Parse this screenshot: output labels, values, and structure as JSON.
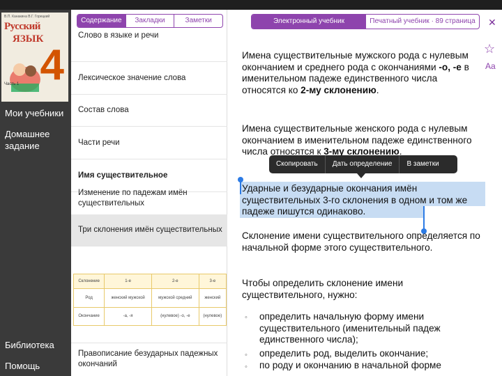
{
  "cover": {
    "authors": "В.П. Канакина  В.Г. Горецкий",
    "title_line1": "Русский",
    "title_line2": "ЯЗЫК",
    "grade": "4",
    "part": "Часть 1"
  },
  "sidebar": {
    "my_textbooks": "Мои учебники",
    "homework": "Домашнее задание",
    "library": "Библиотека",
    "help": "Помощь"
  },
  "toc_tabs": [
    "Содержание",
    "Закладки",
    "Заметки"
  ],
  "toc_items": [
    "Слово в языке и речи",
    "Лексическое значение слова",
    "Состав слова",
    "Части речи",
    "Имя существительное",
    "Изменение по падежам имён существительных",
    "Три склонения имён существительных",
    "Правописание безударных падежных окончаний"
  ],
  "mini_table": {
    "headers": [
      "Склонение",
      "1-е",
      "2-е",
      "3-е"
    ],
    "row1": [
      "Род",
      "женский мужской",
      "мужской средний",
      "женский"
    ],
    "row2": [
      "Окончание",
      "-а, -я",
      "(нулевое) -о, -е",
      "(нулевое)"
    ]
  },
  "reader_tabs": {
    "electronic": "Электронный учебник",
    "print": "Печатный учебник · 89 страница"
  },
  "toolbar": {
    "close": "✕",
    "bookmark": "☆",
    "font": "Aa"
  },
  "content": {
    "p1_before": "Имена существительные мужского рода с нулевым окончанием и среднего рода с окончаниями ",
    "p1_endings": "-о, -е",
    "p1_after": " в именительном падеже единственного числа относятся ко ",
    "p1_bold": "2-му склонению",
    "p1_end": ".",
    "p2_before": "Имена существительные женского рода с нулевым окончанием в именительном падеже единственного числа относятся к ",
    "p2_bold": "3-му склонению",
    "p2_end": ".",
    "p3": "Ударные и безударные окончания имён существительных 3-го склонения в одном и том же падеже пишутся одинаково.",
    "p4": "Склонение имени существительного определяется по начальной форме этого существительного.",
    "p5": "Чтобы определить склонение имени существительного, нужно:",
    "bullets": [
      "определить начальную форму имени существительного (именительный падеж единственного числа);",
      "определить род, выделить окончание;",
      "по роду и окончанию в начальной форме"
    ],
    "bullet_glyph": "◦"
  },
  "popup_menu": [
    "Скопировать",
    "Дать определение",
    "В заметки"
  ],
  "colors": {
    "accent": "#8e44ad",
    "selection": "#c7dcf3",
    "sidebar": "#3a3a3a"
  }
}
